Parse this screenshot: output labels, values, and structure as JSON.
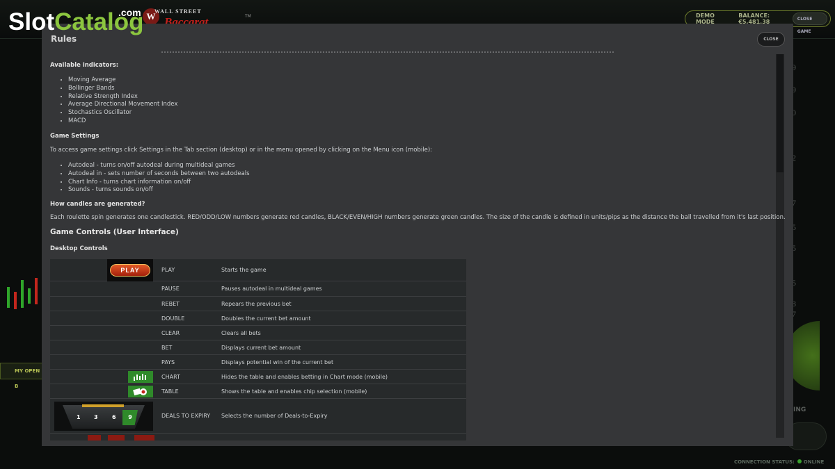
{
  "watermark": {
    "slot": "Slot",
    "catalog": "Catalog",
    "com": ".com"
  },
  "game": {
    "logo_top": "WALL STREET",
    "logo_main": "Baccarat",
    "logo_w": "W",
    "logo_tm": "TM",
    "demo_mode": "DEMO MODE",
    "balance": "BALANCE: €5,481.38",
    "close_game": "CLOSE GAME",
    "my_open_bets": "MY OPEN B",
    "ring_label": "ING",
    "connection_status": "CONNECTION STATUS:",
    "connection_value": "ONLINE",
    "side_numbers": [
      "9",
      "9",
      "0",
      "2",
      "7",
      "5",
      "5",
      "5",
      "8",
      "7"
    ]
  },
  "modal": {
    "title": "Rules",
    "close_label": "CLOSE",
    "available_indicators_heading": "Available indicators:",
    "indicators": [
      "Moving Average",
      "Bollinger Bands",
      "Relative Strength Index",
      "Average Directional Movement Index",
      "Stochastics Oscillator",
      "MACD"
    ],
    "game_settings_heading": "Game Settings",
    "game_settings_intro": "To access game settings click Settings in the Tab section (desktop) or in the menu opened by clicking on the Menu icon (mobile):",
    "settings": [
      "Autodeal - turns on/off autodeal during multideal games",
      "Autodeal in - sets number of seconds between two autodeals",
      "Chart Info - turns chart information on/off",
      "Sounds - turns sounds on/off"
    ],
    "candles_heading": "How candles are generated?",
    "candles_text": "Each roulette spin generates one candlestick. RED/ODD/LOW numbers generate red candles, BLACK/EVEN/HIGH numbers generate green candles. The size of the candle is defined in units/pips as the distance the ball travelled from it's last position.",
    "controls_heading": "Game Controls (User Interface)",
    "desktop_controls_heading": "Desktop Controls",
    "play_icon_label": "PLAY",
    "expiry_numbers": [
      "1",
      "3",
      "6",
      "9"
    ],
    "controls": [
      {
        "name": "PLAY",
        "desc": "Starts the game"
      },
      {
        "name": "PAUSE",
        "desc": "Pauses autodeal in multideal games"
      },
      {
        "name": "REBET",
        "desc": "Repears the previous bet"
      },
      {
        "name": "DOUBLE",
        "desc": "Doubles the current bet amount"
      },
      {
        "name": "CLEAR",
        "desc": "Clears all bets"
      },
      {
        "name": "BET",
        "desc": "Displays current bet amount"
      },
      {
        "name": "PAYS",
        "desc": "Displays potential win of the current bet"
      },
      {
        "name": "CHART",
        "desc": "Hides the table and enables betting in Chart mode (mobile)"
      },
      {
        "name": "TABLE",
        "desc": "Shows the table and enables chip selection (mobile)"
      },
      {
        "name": "DEALS TO EXPIRY",
        "desc": "Selects the number of Deals-to-Expiry"
      }
    ]
  }
}
